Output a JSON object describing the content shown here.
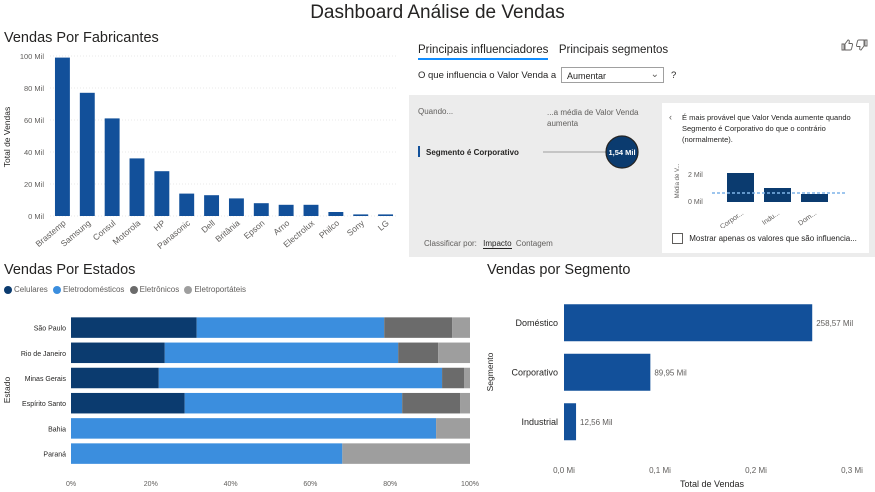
{
  "dashboard": {
    "title": "Dashboard Análise de Vendas"
  },
  "manufacturers": {
    "title": "Vendas Por Fabricantes",
    "ylabel": "Total de Vendas"
  },
  "influencers": {
    "tabs": [
      {
        "label": "Principais influenciadores"
      },
      {
        "label": "Principais segmentos"
      }
    ],
    "question": "O que influencia o Valor Venda a",
    "select_value": "Aumentar",
    "help_label": "?",
    "col_when": "Quando...",
    "col_avg": "...a média de Valor Venda aumenta",
    "factor_label": "Segmento é Corporativo",
    "factor_value": "1,54 Mil",
    "sort_label": "Classificar por:",
    "sort_options": [
      "Impacto",
      "Contagem"
    ],
    "card": {
      "text": "É mais provável que Valor Venda aumente quando Segmento é Corporativo do que o contrário (normalmente).",
      "ylabel": "Média de V...",
      "yticks": [
        "2 Mil",
        "0 Mil"
      ],
      "categories": [
        "Corpor...",
        "Indu...",
        "Dom..."
      ],
      "checkbox_label": "Mostrar apenas os valores que são influencia..."
    }
  },
  "states": {
    "title": "Vendas Por Estados",
    "ylabel": "Estado",
    "legend": [
      {
        "name": "Celulares",
        "color": "#0b3b6f"
      },
      {
        "name": "Eletrodomésticos",
        "color": "#3b8ede"
      },
      {
        "name": "Eletrônicos",
        "color": "#6b6b6b"
      },
      {
        "name": "Eletroportáteis",
        "color": "#9e9e9e"
      }
    ]
  },
  "segments": {
    "title": "Vendas por Segmento",
    "ylabel": "Segmento",
    "xlabel": "Total de Vendas"
  },
  "chart_data": [
    {
      "type": "bar",
      "title": "Vendas Por Fabricantes",
      "ylabel": "Total de Vendas",
      "categories": [
        "Brastemp",
        "Samsung",
        "Consul",
        "Motorola",
        "HP",
        "Panasonic",
        "Dell",
        "Britânia",
        "Epson",
        "Arno",
        "Electrolux",
        "Philco",
        "Sony",
        "LG"
      ],
      "values": [
        99,
        77,
        61,
        36,
        28,
        14,
        13,
        11,
        8,
        7,
        7,
        2.5,
        1,
        1
      ],
      "unit": "Mil",
      "ylim": [
        0,
        100
      ],
      "yticks": [
        "100 Mil",
        "80 Mil",
        "60 Mil",
        "40 Mil",
        "20 Mil",
        "0 Mil"
      ],
      "color": "#12509a"
    },
    {
      "type": "bar",
      "title": "Vendas Por Estados",
      "orientation": "horizontal-stacked-100",
      "ylabel": "Estado",
      "categories": [
        "São Paulo",
        "Rio de Janeiro",
        "Minas Gerais",
        "Espírito Santo",
        "Bahia",
        "Paraná"
      ],
      "series": [
        {
          "name": "Celulares",
          "values": [
            31.5,
            23.5,
            22,
            28.5,
            0,
            0
          ]
        },
        {
          "name": "Eletrodomésticos",
          "values": [
            47,
            58.5,
            71,
            54.5,
            91.5,
            68
          ]
        },
        {
          "name": "Eletrônicos",
          "values": [
            17,
            10,
            5.5,
            14.5,
            0,
            0
          ]
        },
        {
          "name": "Eletroportáteis",
          "values": [
            4.5,
            8,
            1.5,
            2.5,
            8.5,
            32
          ]
        }
      ],
      "xticks": [
        "0%",
        "20%",
        "40%",
        "60%",
        "80%",
        "100%"
      ],
      "xlim": [
        0,
        100
      ]
    },
    {
      "type": "bar",
      "title": "Vendas por Segmento",
      "orientation": "horizontal",
      "ylabel": "Segmento",
      "xlabel": "Total de Vendas",
      "categories": [
        "Doméstico",
        "Corporativo",
        "Industrial"
      ],
      "values": [
        258.57,
        89.95,
        12.56
      ],
      "data_labels": [
        "258,57 Mil",
        "89,95 Mil",
        "12,56 Mil"
      ],
      "xticks": [
        "0,0 Mi",
        "0,1 Mi",
        "0,2 Mi",
        "0,3 Mi"
      ],
      "xlim": [
        0,
        300
      ],
      "color": "#12509a"
    }
  ]
}
